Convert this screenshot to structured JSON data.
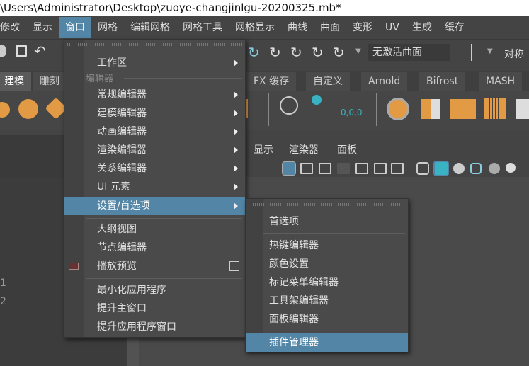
{
  "title": "\\Users\\Administrator\\Desktop\\zuoye-changjinlgu-20200325.mb*",
  "menubar": [
    "修改",
    "显示",
    "窗口",
    "网格",
    "编辑网格",
    "网格工具",
    "网格显示",
    "曲线",
    "曲面",
    "变形",
    "UV",
    "生成",
    "缓存"
  ],
  "toolbar": {
    "curve_field": "无激活曲面",
    "symmetry": "对称"
  },
  "shelf_tabs": [
    "建模",
    "雕刻",
    "FX 缓存",
    "自定义",
    "Arnold",
    "Bifrost",
    "MASH"
  ],
  "shelf": {
    "coord_label": "0,0,0"
  },
  "panel_menu": [
    "显示",
    "渲染器",
    "面板"
  ],
  "left_panel": {
    "numbers": [
      "1",
      "2"
    ]
  },
  "accent": "#5285a6",
  "window_menu": {
    "workspace": "工作区",
    "section_editors": "编辑器",
    "items": [
      "常规编辑器",
      "建模编辑器",
      "动画编辑器",
      "渲染编辑器",
      "关系编辑器",
      "UI 元素",
      "设置/首选项"
    ],
    "items2": [
      "大纲视图",
      "节点编辑器",
      "播放预览"
    ],
    "items3": [
      "最小化应用程序",
      "提升主窗口",
      "提升应用程序窗口"
    ]
  },
  "submenu": {
    "items": [
      "首选项",
      "热键编辑器",
      "颜色设置",
      "标记菜单编辑器",
      "工具架编辑器",
      "面板编辑器",
      "插件管理器"
    ]
  }
}
